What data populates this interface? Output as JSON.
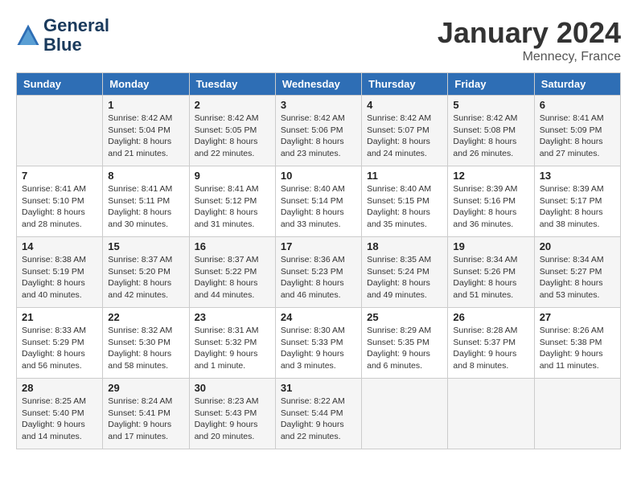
{
  "logo": {
    "line1": "General",
    "line2": "Blue"
  },
  "title": "January 2024",
  "location": "Mennecy, France",
  "weekdays": [
    "Sunday",
    "Monday",
    "Tuesday",
    "Wednesday",
    "Thursday",
    "Friday",
    "Saturday"
  ],
  "weeks": [
    [
      {
        "day": "",
        "sunrise": "",
        "sunset": "",
        "daylight": ""
      },
      {
        "day": "1",
        "sunrise": "Sunrise: 8:42 AM",
        "sunset": "Sunset: 5:04 PM",
        "daylight": "Daylight: 8 hours and 21 minutes."
      },
      {
        "day": "2",
        "sunrise": "Sunrise: 8:42 AM",
        "sunset": "Sunset: 5:05 PM",
        "daylight": "Daylight: 8 hours and 22 minutes."
      },
      {
        "day": "3",
        "sunrise": "Sunrise: 8:42 AM",
        "sunset": "Sunset: 5:06 PM",
        "daylight": "Daylight: 8 hours and 23 minutes."
      },
      {
        "day": "4",
        "sunrise": "Sunrise: 8:42 AM",
        "sunset": "Sunset: 5:07 PM",
        "daylight": "Daylight: 8 hours and 24 minutes."
      },
      {
        "day": "5",
        "sunrise": "Sunrise: 8:42 AM",
        "sunset": "Sunset: 5:08 PM",
        "daylight": "Daylight: 8 hours and 26 minutes."
      },
      {
        "day": "6",
        "sunrise": "Sunrise: 8:41 AM",
        "sunset": "Sunset: 5:09 PM",
        "daylight": "Daylight: 8 hours and 27 minutes."
      }
    ],
    [
      {
        "day": "7",
        "sunrise": "Sunrise: 8:41 AM",
        "sunset": "Sunset: 5:10 PM",
        "daylight": "Daylight: 8 hours and 28 minutes."
      },
      {
        "day": "8",
        "sunrise": "Sunrise: 8:41 AM",
        "sunset": "Sunset: 5:11 PM",
        "daylight": "Daylight: 8 hours and 30 minutes."
      },
      {
        "day": "9",
        "sunrise": "Sunrise: 8:41 AM",
        "sunset": "Sunset: 5:12 PM",
        "daylight": "Daylight: 8 hours and 31 minutes."
      },
      {
        "day": "10",
        "sunrise": "Sunrise: 8:40 AM",
        "sunset": "Sunset: 5:14 PM",
        "daylight": "Daylight: 8 hours and 33 minutes."
      },
      {
        "day": "11",
        "sunrise": "Sunrise: 8:40 AM",
        "sunset": "Sunset: 5:15 PM",
        "daylight": "Daylight: 8 hours and 35 minutes."
      },
      {
        "day": "12",
        "sunrise": "Sunrise: 8:39 AM",
        "sunset": "Sunset: 5:16 PM",
        "daylight": "Daylight: 8 hours and 36 minutes."
      },
      {
        "day": "13",
        "sunrise": "Sunrise: 8:39 AM",
        "sunset": "Sunset: 5:17 PM",
        "daylight": "Daylight: 8 hours and 38 minutes."
      }
    ],
    [
      {
        "day": "14",
        "sunrise": "Sunrise: 8:38 AM",
        "sunset": "Sunset: 5:19 PM",
        "daylight": "Daylight: 8 hours and 40 minutes."
      },
      {
        "day": "15",
        "sunrise": "Sunrise: 8:37 AM",
        "sunset": "Sunset: 5:20 PM",
        "daylight": "Daylight: 8 hours and 42 minutes."
      },
      {
        "day": "16",
        "sunrise": "Sunrise: 8:37 AM",
        "sunset": "Sunset: 5:22 PM",
        "daylight": "Daylight: 8 hours and 44 minutes."
      },
      {
        "day": "17",
        "sunrise": "Sunrise: 8:36 AM",
        "sunset": "Sunset: 5:23 PM",
        "daylight": "Daylight: 8 hours and 46 minutes."
      },
      {
        "day": "18",
        "sunrise": "Sunrise: 8:35 AM",
        "sunset": "Sunset: 5:24 PM",
        "daylight": "Daylight: 8 hours and 49 minutes."
      },
      {
        "day": "19",
        "sunrise": "Sunrise: 8:34 AM",
        "sunset": "Sunset: 5:26 PM",
        "daylight": "Daylight: 8 hours and 51 minutes."
      },
      {
        "day": "20",
        "sunrise": "Sunrise: 8:34 AM",
        "sunset": "Sunset: 5:27 PM",
        "daylight": "Daylight: 8 hours and 53 minutes."
      }
    ],
    [
      {
        "day": "21",
        "sunrise": "Sunrise: 8:33 AM",
        "sunset": "Sunset: 5:29 PM",
        "daylight": "Daylight: 8 hours and 56 minutes."
      },
      {
        "day": "22",
        "sunrise": "Sunrise: 8:32 AM",
        "sunset": "Sunset: 5:30 PM",
        "daylight": "Daylight: 8 hours and 58 minutes."
      },
      {
        "day": "23",
        "sunrise": "Sunrise: 8:31 AM",
        "sunset": "Sunset: 5:32 PM",
        "daylight": "Daylight: 9 hours and 1 minute."
      },
      {
        "day": "24",
        "sunrise": "Sunrise: 8:30 AM",
        "sunset": "Sunset: 5:33 PM",
        "daylight": "Daylight: 9 hours and 3 minutes."
      },
      {
        "day": "25",
        "sunrise": "Sunrise: 8:29 AM",
        "sunset": "Sunset: 5:35 PM",
        "daylight": "Daylight: 9 hours and 6 minutes."
      },
      {
        "day": "26",
        "sunrise": "Sunrise: 8:28 AM",
        "sunset": "Sunset: 5:37 PM",
        "daylight": "Daylight: 9 hours and 8 minutes."
      },
      {
        "day": "27",
        "sunrise": "Sunrise: 8:26 AM",
        "sunset": "Sunset: 5:38 PM",
        "daylight": "Daylight: 9 hours and 11 minutes."
      }
    ],
    [
      {
        "day": "28",
        "sunrise": "Sunrise: 8:25 AM",
        "sunset": "Sunset: 5:40 PM",
        "daylight": "Daylight: 9 hours and 14 minutes."
      },
      {
        "day": "29",
        "sunrise": "Sunrise: 8:24 AM",
        "sunset": "Sunset: 5:41 PM",
        "daylight": "Daylight: 9 hours and 17 minutes."
      },
      {
        "day": "30",
        "sunrise": "Sunrise: 8:23 AM",
        "sunset": "Sunset: 5:43 PM",
        "daylight": "Daylight: 9 hours and 20 minutes."
      },
      {
        "day": "31",
        "sunrise": "Sunrise: 8:22 AM",
        "sunset": "Sunset: 5:44 PM",
        "daylight": "Daylight: 9 hours and 22 minutes."
      },
      {
        "day": "",
        "sunrise": "",
        "sunset": "",
        "daylight": ""
      },
      {
        "day": "",
        "sunrise": "",
        "sunset": "",
        "daylight": ""
      },
      {
        "day": "",
        "sunrise": "",
        "sunset": "",
        "daylight": ""
      }
    ]
  ]
}
